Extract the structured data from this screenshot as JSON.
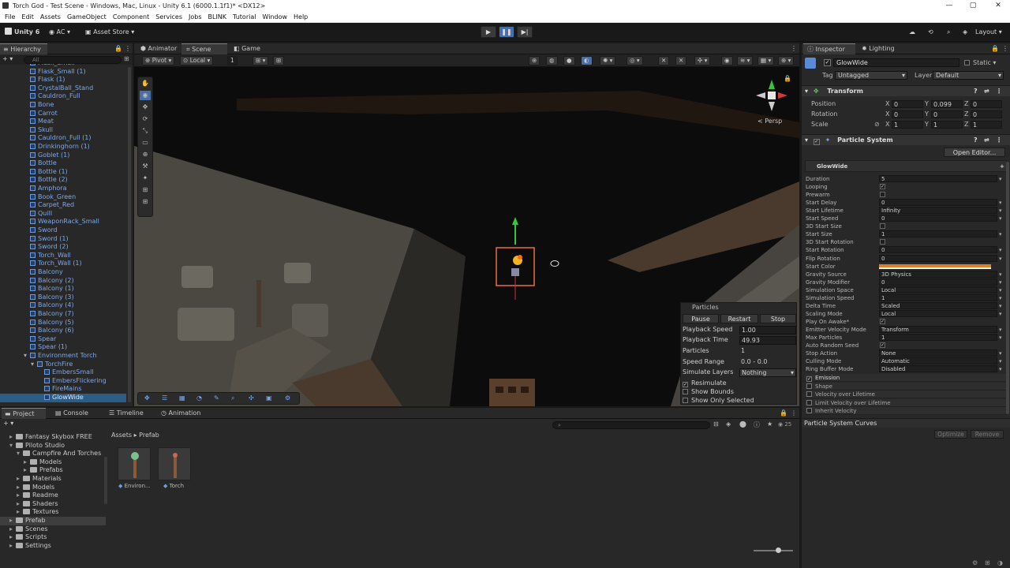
{
  "window": {
    "title": "Torch God - Test Scene - Windows, Mac, Linux - Unity 6.1 (6000.1.1f1)* <DX12>"
  },
  "menu": [
    "File",
    "Edit",
    "Assets",
    "GameObject",
    "Component",
    "Services",
    "Jobs",
    "BLINK",
    "Tutorial",
    "Window",
    "Help"
  ],
  "toolbar": {
    "unity": "Unity 6",
    "account": "AC",
    "asset_store": "Asset Store",
    "layout": "Layout"
  },
  "hierarchy": {
    "tab": "Hierarchy",
    "search": "All",
    "items": [
      {
        "label": "Flask_Small",
        "indent": 1
      },
      {
        "label": "Flask_Small (1)",
        "indent": 1
      },
      {
        "label": "Flask (1)",
        "indent": 1
      },
      {
        "label": "CrystalBall_Stand",
        "indent": 1
      },
      {
        "label": "Cauldron_Full",
        "indent": 1
      },
      {
        "label": "Bone",
        "indent": 1
      },
      {
        "label": "Carrot",
        "indent": 1
      },
      {
        "label": "Meat",
        "indent": 1
      },
      {
        "label": "Skull",
        "indent": 1
      },
      {
        "label": "Cauldron_Full (1)",
        "indent": 1
      },
      {
        "label": "Drinkinghorn (1)",
        "indent": 1
      },
      {
        "label": "Goblet (1)",
        "indent": 1
      },
      {
        "label": "Bottle",
        "indent": 1
      },
      {
        "label": "Bottle (1)",
        "indent": 1
      },
      {
        "label": "Bottle (2)",
        "indent": 1
      },
      {
        "label": "Amphora",
        "indent": 1
      },
      {
        "label": "Book_Green",
        "indent": 1
      },
      {
        "label": "Carpet_Red",
        "indent": 1
      },
      {
        "label": "Quill",
        "indent": 1
      },
      {
        "label": "WeaponRack_Small",
        "indent": 1
      },
      {
        "label": "Sword",
        "indent": 1
      },
      {
        "label": "Sword (1)",
        "indent": 1
      },
      {
        "label": "Sword (2)",
        "indent": 1
      },
      {
        "label": "Torch_Wall",
        "indent": 1
      },
      {
        "label": "Torch_Wall (1)",
        "indent": 1
      },
      {
        "label": "Balcony",
        "indent": 1
      },
      {
        "label": "Balcony (2)",
        "indent": 1
      },
      {
        "label": "Balcony (1)",
        "indent": 1
      },
      {
        "label": "Balcony (3)",
        "indent": 1
      },
      {
        "label": "Balcony (4)",
        "indent": 1
      },
      {
        "label": "Balcony (7)",
        "indent": 1
      },
      {
        "label": "Balcony (5)",
        "indent": 1
      },
      {
        "label": "Balcony (6)",
        "indent": 1
      },
      {
        "label": "Spear",
        "indent": 1
      },
      {
        "label": "Spear (1)",
        "indent": 1
      },
      {
        "label": "Environment Torch",
        "indent": 1
      },
      {
        "label": "TorchFire",
        "indent": 2
      },
      {
        "label": "EmbersSmall",
        "indent": 3
      },
      {
        "label": "EmbersFlickering",
        "indent": 3
      },
      {
        "label": "FireMains",
        "indent": 3
      },
      {
        "label": "GlowWide",
        "indent": 3
      }
    ]
  },
  "scene_tabs": [
    "Animator",
    "Scene",
    "Game"
  ],
  "scene_tools": {
    "pivot": "Pivot",
    "local": "Local",
    "grid": "1",
    "persp": "< Persp"
  },
  "particles_panel": {
    "title": "Particles",
    "buttons": [
      "Pause",
      "Restart",
      "Stop"
    ],
    "rows": [
      {
        "label": "Playback Speed",
        "value": "1.00"
      },
      {
        "label": "Playback Time",
        "value": "49.93"
      },
      {
        "label": "Particles",
        "value": "1"
      },
      {
        "label": "Speed Range",
        "value": "0.0 - 0.0"
      },
      {
        "label": "Simulate Layers",
        "value": "Nothing"
      }
    ],
    "checks": [
      {
        "label": "Resimulate",
        "checked": true
      },
      {
        "label": "Show Bounds",
        "checked": false
      },
      {
        "label": "Show Only Selected",
        "checked": false
      }
    ]
  },
  "inspector": {
    "tabs": [
      "Inspector",
      "Lighting"
    ],
    "object_name": "GlowWide",
    "static": "Static",
    "tag_label": "Tag",
    "tag": "Untagged",
    "layer_label": "Layer",
    "layer": "Default",
    "transform": {
      "title": "Transform",
      "rows": [
        {
          "label": "Position",
          "x": "0",
          "y": "0.099",
          "z": "0"
        },
        {
          "label": "Rotation",
          "x": "0",
          "y": "0",
          "z": "0"
        },
        {
          "label": "Scale",
          "x": "1",
          "y": "1",
          "z": "1"
        }
      ]
    },
    "particle_system": {
      "title": "Particle System",
      "open_editor": "Open Editor...",
      "module_name": "GlowWide",
      "rows": [
        {
          "k": "Duration",
          "v": "5"
        },
        {
          "k": "Looping",
          "cb": "✓"
        },
        {
          "k": "Prewarm",
          "cb": ""
        },
        {
          "k": "Start Delay",
          "v": "0"
        },
        {
          "k": "Start Lifetime",
          "v": "Infinity"
        },
        {
          "k": "Start Speed",
          "v": "0"
        },
        {
          "k": "3D Start Size",
          "cb": ""
        },
        {
          "k": "Start Size",
          "v": "1"
        },
        {
          "k": "3D Start Rotation",
          "cb": ""
        },
        {
          "k": "Start Rotation",
          "v": "0"
        },
        {
          "k": "Flip Rotation",
          "v": "0"
        },
        {
          "k": "Start Color",
          "color": "#d9822b"
        },
        {
          "k": "Gravity Source",
          "v": "3D Physics"
        },
        {
          "k": "Gravity Modifier",
          "v": "0"
        },
        {
          "k": "Simulation Space",
          "v": "Local"
        },
        {
          "k": "Simulation Speed",
          "v": "1"
        },
        {
          "k": "Delta Time",
          "v": "Scaled"
        },
        {
          "k": "Scaling Mode",
          "v": "Local"
        },
        {
          "k": "Play On Awake*",
          "cb": "✓"
        },
        {
          "k": "Emitter Velocity Mode",
          "v": "Transform"
        },
        {
          "k": "Max Particles",
          "v": "1"
        },
        {
          "k": "Auto Random Seed",
          "cb": "✓"
        },
        {
          "k": "Stop Action",
          "v": "None"
        },
        {
          "k": "Culling Mode",
          "v": "Automatic"
        },
        {
          "k": "Ring Buffer Mode",
          "v": "Disabled"
        }
      ],
      "modules": [
        {
          "label": "Emission",
          "checked": true
        },
        {
          "label": "Shape",
          "checked": false
        },
        {
          "label": "Velocity over Lifetime",
          "checked": false
        },
        {
          "label": "Limit Velocity over Lifetime",
          "checked": false
        },
        {
          "label": "Inherit Velocity",
          "checked": false
        }
      ],
      "curves_title": "Particle System Curves",
      "optimize": "Optimize",
      "remove": "Remove"
    }
  },
  "project": {
    "tabs": [
      "Project",
      "Console",
      "Timeline",
      "Animation"
    ],
    "tree": [
      {
        "label": "Fantasy Skybox FREE",
        "indent": 1
      },
      {
        "label": "Piloto Studio",
        "indent": 1
      },
      {
        "label": "Campfire And Torches",
        "indent": 2
      },
      {
        "label": "Models",
        "indent": 3
      },
      {
        "label": "Prefabs",
        "indent": 3
      },
      {
        "label": "Materials",
        "indent": 2
      },
      {
        "label": "Models",
        "indent": 2
      },
      {
        "label": "Readme",
        "indent": 2
      },
      {
        "label": "Shaders",
        "indent": 2
      },
      {
        "label": "Textures",
        "indent": 2
      },
      {
        "label": "Prefab",
        "indent": 1
      },
      {
        "label": "Scenes",
        "indent": 1
      },
      {
        "label": "Scripts",
        "indent": 1
      },
      {
        "label": "Settings",
        "indent": 1
      }
    ],
    "breadcrumb": [
      "Assets",
      "Prefab"
    ],
    "count": "25",
    "assets": [
      {
        "label": "Environ..."
      },
      {
        "label": "Torch"
      }
    ]
  }
}
